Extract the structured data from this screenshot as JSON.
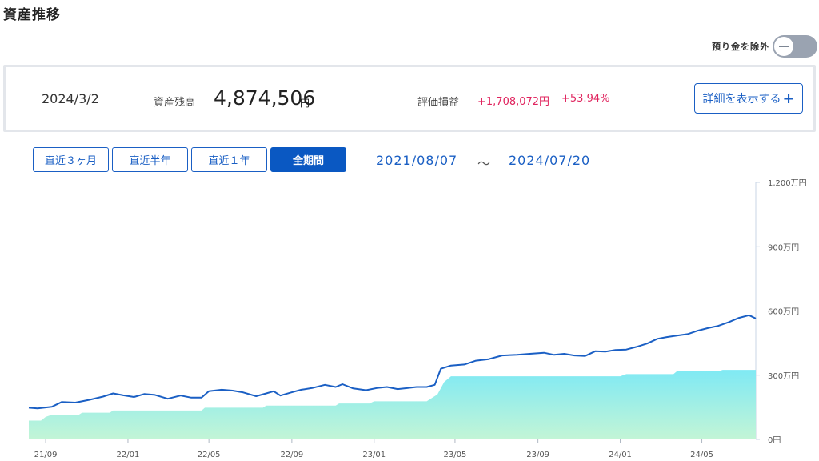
{
  "page": {
    "title": "資産推移"
  },
  "toggle": {
    "label": "預り金を除外",
    "state": "off"
  },
  "summary": {
    "date": "2024/3/2",
    "assets_label": "資産残高",
    "assets_value": "4,874,506",
    "assets_unit": "円",
    "pl_label": "評価損益",
    "pl_value": "+1,708,072円",
    "pl_percent": "+53.94%",
    "detail_button": "詳細を表示する",
    "detail_button_icon": "+"
  },
  "periods": {
    "buttons": [
      "直近３ヶ月",
      "直近半年",
      "直近１年",
      "全期間"
    ],
    "active": "全期間"
  },
  "range": {
    "start": "2021/08/07",
    "separator": "～",
    "end": "2024/07/20"
  },
  "colors": {
    "accent": "#1a5fc4",
    "active_button": "#0a58c2",
    "gain": "#e0245e",
    "line": "#1a5fc4",
    "area_top": "#7fe9f4",
    "area_bottom": "#c3f5d6"
  },
  "chart_data": {
    "type": "line",
    "x_range": [
      "2021-08-07",
      "2024-07-20"
    ],
    "xticks": [
      "21/09",
      "22/01",
      "22/05",
      "22/09",
      "23/01",
      "23/05",
      "23/09",
      "24/01",
      "24/05"
    ],
    "yticks": [
      "0円",
      "300万円",
      "600万円",
      "900万円",
      "1,200万円"
    ],
    "ylim": [
      0,
      1200
    ],
    "y_unit": "万円",
    "grid": false,
    "series": [
      {
        "role": "total_assets",
        "style": "line",
        "points": [
          [
            "2021-08-07",
            148
          ],
          [
            "2021-08-20",
            145
          ],
          [
            "2021-09-10",
            152
          ],
          [
            "2021-09-25",
            175
          ],
          [
            "2021-10-15",
            172
          ],
          [
            "2021-11-05",
            185
          ],
          [
            "2021-11-25",
            200
          ],
          [
            "2021-12-10",
            215
          ],
          [
            "2021-12-25",
            206
          ],
          [
            "2022-01-10",
            198
          ],
          [
            "2022-01-25",
            212
          ],
          [
            "2022-02-10",
            208
          ],
          [
            "2022-03-01",
            190
          ],
          [
            "2022-03-20",
            205
          ],
          [
            "2022-04-05",
            195
          ],
          [
            "2022-04-20",
            195
          ],
          [
            "2022-05-01",
            225
          ],
          [
            "2022-05-20",
            232
          ],
          [
            "2022-06-05",
            228
          ],
          [
            "2022-06-20",
            220
          ],
          [
            "2022-07-10",
            202
          ],
          [
            "2022-07-25",
            215
          ],
          [
            "2022-08-05",
            225
          ],
          [
            "2022-08-15",
            205
          ],
          [
            "2022-09-01",
            220
          ],
          [
            "2022-09-15",
            232
          ],
          [
            "2022-10-01",
            240
          ],
          [
            "2022-10-20",
            255
          ],
          [
            "2022-11-05",
            245
          ],
          [
            "2022-11-15",
            258
          ],
          [
            "2022-12-01",
            238
          ],
          [
            "2022-12-20",
            230
          ],
          [
            "2023-01-05",
            240
          ],
          [
            "2023-01-20",
            245
          ],
          [
            "2023-02-05",
            235
          ],
          [
            "2023-02-20",
            240
          ],
          [
            "2023-03-05",
            245
          ],
          [
            "2023-03-20",
            245
          ],
          [
            "2023-04-01",
            255
          ],
          [
            "2023-04-10",
            330
          ],
          [
            "2023-04-25",
            345
          ],
          [
            "2023-05-15",
            350
          ],
          [
            "2023-06-01",
            368
          ],
          [
            "2023-06-20",
            375
          ],
          [
            "2023-07-10",
            392
          ],
          [
            "2023-08-01",
            395
          ],
          [
            "2023-08-20",
            400
          ],
          [
            "2023-09-10",
            405
          ],
          [
            "2023-09-25",
            395
          ],
          [
            "2023-10-10",
            400
          ],
          [
            "2023-10-25",
            392
          ],
          [
            "2023-11-10",
            390
          ],
          [
            "2023-11-25",
            412
          ],
          [
            "2023-12-10",
            410
          ],
          [
            "2023-12-25",
            418
          ],
          [
            "2024-01-10",
            420
          ],
          [
            "2024-01-25",
            432
          ],
          [
            "2024-02-10",
            448
          ],
          [
            "2024-02-25",
            470
          ],
          [
            "2024-03-10",
            478
          ],
          [
            "2024-03-25",
            485
          ],
          [
            "2024-04-10",
            492
          ],
          [
            "2024-04-25",
            508
          ],
          [
            "2024-05-10",
            520
          ],
          [
            "2024-05-25",
            530
          ],
          [
            "2024-06-10",
            548
          ],
          [
            "2024-06-25",
            568
          ],
          [
            "2024-07-10",
            580
          ],
          [
            "2024-07-20",
            565
          ]
        ]
      },
      {
        "role": "deposits",
        "style": "area",
        "points": [
          [
            "2021-08-07",
            88
          ],
          [
            "2021-08-25",
            88
          ],
          [
            "2021-09-01",
            105
          ],
          [
            "2021-09-10",
            115
          ],
          [
            "2021-10-20",
            115
          ],
          [
            "2021-10-25",
            125
          ],
          [
            "2021-12-05",
            125
          ],
          [
            "2021-12-10",
            135
          ],
          [
            "2022-04-20",
            135
          ],
          [
            "2022-04-25",
            148
          ],
          [
            "2022-07-20",
            148
          ],
          [
            "2022-07-25",
            158
          ],
          [
            "2022-11-05",
            158
          ],
          [
            "2022-11-10",
            168
          ],
          [
            "2022-12-25",
            168
          ],
          [
            "2023-01-01",
            178
          ],
          [
            "2023-03-20",
            178
          ],
          [
            "2023-04-05",
            210
          ],
          [
            "2023-04-15",
            268
          ],
          [
            "2023-04-25",
            295
          ],
          [
            "2024-01-01",
            295
          ],
          [
            "2024-01-10",
            305
          ],
          [
            "2024-03-20",
            305
          ],
          [
            "2024-03-25",
            318
          ],
          [
            "2024-05-25",
            318
          ],
          [
            "2024-06-01",
            325
          ],
          [
            "2024-07-20",
            325
          ]
        ]
      }
    ]
  }
}
